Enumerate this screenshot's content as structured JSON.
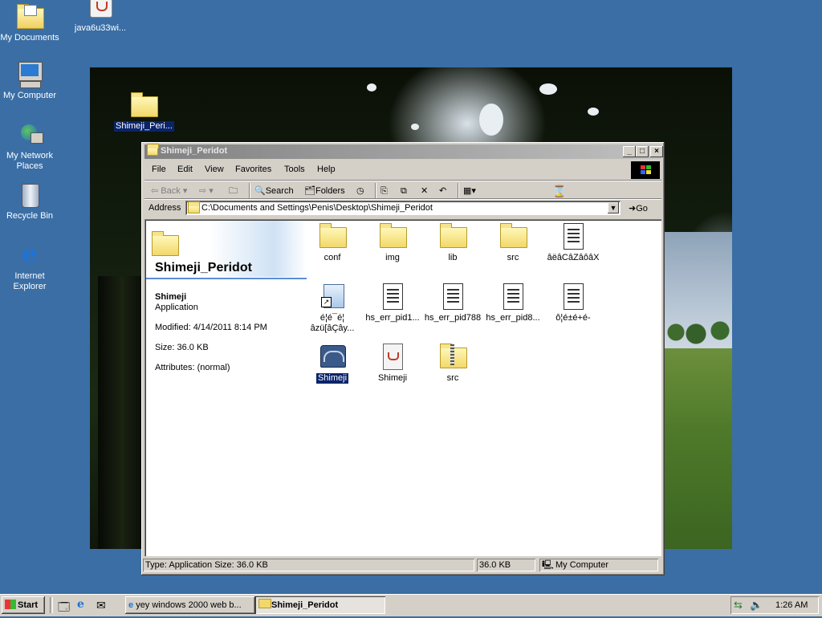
{
  "desktop": {
    "icons": [
      {
        "label": "My Documents"
      },
      {
        "label": "java6u33wi..."
      },
      {
        "label": "My Computer"
      },
      {
        "label": "My Network Places"
      },
      {
        "label": "Recycle Bin"
      },
      {
        "label": "Internet Explorer"
      },
      {
        "label": "Shimeji_Peri..."
      }
    ]
  },
  "window": {
    "title": "Shimeji_Peridot",
    "controls": {
      "minimize": "_",
      "maximize": "□",
      "close": "×"
    },
    "menu": [
      "File",
      "Edit",
      "View",
      "Favorites",
      "Tools",
      "Help"
    ],
    "toolbar": {
      "back": "Back",
      "forward": "",
      "search": "Search",
      "folders": "Folders"
    },
    "address": {
      "label": "Address",
      "value": "C:\\Documents and Settings\\Penis\\Desktop\\Shimeji_Peridot",
      "go": "Go"
    },
    "webview": {
      "folder_title": "Shimeji_Peridot",
      "selected_name": "Shimeji",
      "selected_type": "Application",
      "modified": "Modified: 4/14/2011 8:14 PM",
      "size": "Size: 36.0 KB",
      "attributes": "Attributes: (normal)"
    },
    "files": [
      {
        "name": "conf",
        "icon": "folder-icon"
      },
      {
        "name": "img",
        "icon": "folder-icon"
      },
      {
        "name": "lib",
        "icon": "folder-icon"
      },
      {
        "name": "src",
        "icon": "folder-icon"
      },
      {
        "name": "âëâCâZâôâX",
        "icon": "text-document-icon"
      },
      {
        "name": "é¦é¯é¦ âzü[âÇây...",
        "icon": "shortcut-icon"
      },
      {
        "name": "hs_err_pid1...",
        "icon": "text-document-icon"
      },
      {
        "name": "hs_err_pid788",
        "icon": "text-document-icon"
      },
      {
        "name": "hs_err_pid8...",
        "icon": "text-document-icon"
      },
      {
        "name": "ô¦é±é+é-",
        "icon": "text-document-icon"
      },
      {
        "name": "Shimeji",
        "icon": "application-icon",
        "selected": true
      },
      {
        "name": "Shimeji",
        "icon": "java-jar-icon"
      },
      {
        "name": "src",
        "icon": "zip-folder-icon"
      }
    ],
    "status": {
      "info": "Type: Application Size: 36.0 KB",
      "size": "36.0 KB",
      "zone": "My Computer"
    }
  },
  "taskbar": {
    "start": "Start",
    "tasks": [
      {
        "label": "yey windows 2000 web b..."
      },
      {
        "label": "Shimeji_Peridot",
        "active": true
      }
    ],
    "clock": "1:26 AM"
  }
}
